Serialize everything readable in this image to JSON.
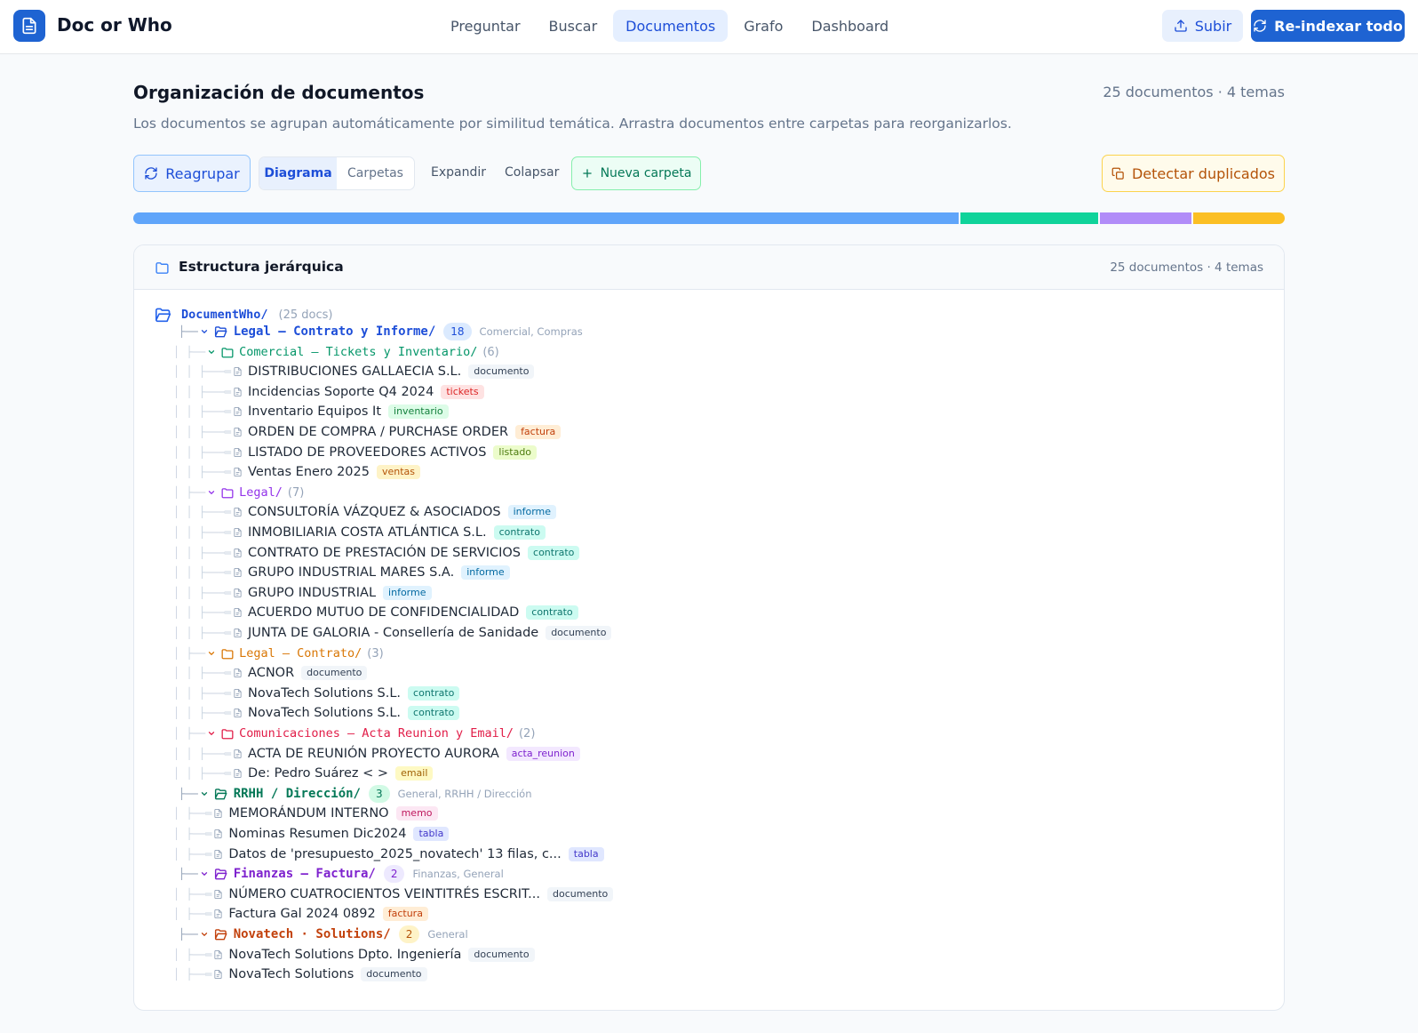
{
  "app": {
    "title": "Doc or Who"
  },
  "nav": {
    "tabs": [
      {
        "label": "Preguntar",
        "active": false
      },
      {
        "label": "Buscar",
        "active": false
      },
      {
        "label": "Documentos",
        "active": true
      },
      {
        "label": "Grafo",
        "active": false
      },
      {
        "label": "Dashboard",
        "active": false
      }
    ]
  },
  "actions": {
    "upload": "Subir",
    "reindex": "Re-indexar todo"
  },
  "page": {
    "title": "Organización de documentos",
    "stats": "25 documentos · 4 temas",
    "description": "Los documentos se agrupan automáticamente por similitud temática. Arrastra documentos entre carpetas para reorganizarlos."
  },
  "toolbar": {
    "regroup": "Reagrupar",
    "view_diagram": "Diagrama",
    "view_folders": "Carpetas",
    "expand": "Expandir",
    "collapse": "Colapsar",
    "new_folder": "Nueva carpeta",
    "detect_duplicates": "Detectar duplicados"
  },
  "distribution": [
    {
      "fraction": 0.72,
      "color": "#60a5fa"
    },
    {
      "fraction": 0.12,
      "color": "#10d39a"
    },
    {
      "fraction": 0.08,
      "color": "#b18cf8"
    },
    {
      "fraction": 0.08,
      "color": "#fbbf24"
    }
  ],
  "tree": {
    "title": "Estructura jerárquica",
    "stats": "25 documentos · 4 temas",
    "root": {
      "name": "DocumentWho/",
      "count": "(25 docs)"
    },
    "rows": [
      {
        "kind": "top",
        "name": "Legal — Contrato y Informe/",
        "pill": "18",
        "topics": "Comercial, Compras",
        "color": "#1d4ed8",
        "pill_bg": "#dbeafe",
        "pill_fg": "#1d4ed8"
      },
      {
        "kind": "sub",
        "name": "Comercial — Tickets y Inventario/",
        "count": "(6)",
        "color": "#059669"
      },
      {
        "kind": "doc",
        "level": 2,
        "name": "DISTRIBUCIONES GALLAECIA S.L.",
        "tag": "documento",
        "tag_bg": "#f1f5f9",
        "tag_fg": "#334155"
      },
      {
        "kind": "doc",
        "level": 2,
        "name": "Incidencias Soporte Q4 2024",
        "tag": "tickets",
        "tag_bg": "#fee2e2",
        "tag_fg": "#dc2626"
      },
      {
        "kind": "doc",
        "level": 2,
        "name": "Inventario Equipos It",
        "tag": "inventario",
        "tag_bg": "#dcfce7",
        "tag_fg": "#15803d"
      },
      {
        "kind": "doc",
        "level": 2,
        "name": "ORDEN DE COMPRA / PURCHASE ORDER",
        "tag": "factura",
        "tag_bg": "#ffedd5",
        "tag_fg": "#c2410c"
      },
      {
        "kind": "doc",
        "level": 2,
        "name": "LISTADO DE PROVEEDORES ACTIVOS",
        "tag": "listado",
        "tag_bg": "#ecfccb",
        "tag_fg": "#4d7c0f"
      },
      {
        "kind": "doc",
        "level": 2,
        "name": "Ventas Enero 2025",
        "tag": "ventas",
        "tag_bg": "#fef3c7",
        "tag_fg": "#b45309"
      },
      {
        "kind": "sub",
        "name": "Legal/",
        "count": "(7)",
        "color": "#9333ea"
      },
      {
        "kind": "doc",
        "level": 2,
        "name": "CONSULTORÍA VÁZQUEZ & ASOCIADOS",
        "tag": "informe",
        "tag_bg": "#e0f2fe",
        "tag_fg": "#0369a1"
      },
      {
        "kind": "doc",
        "level": 2,
        "name": "INMOBILIARIA COSTA ATLÁNTICA S.L.",
        "tag": "contrato",
        "tag_bg": "#ccfbf1",
        "tag_fg": "#0f766e"
      },
      {
        "kind": "doc",
        "level": 2,
        "name": "CONTRATO DE PRESTACIÓN DE SERVICIOS",
        "tag": "contrato",
        "tag_bg": "#ccfbf1",
        "tag_fg": "#0f766e"
      },
      {
        "kind": "doc",
        "level": 2,
        "name": "GRUPO INDUSTRIAL MARES S.A.",
        "tag": "informe",
        "tag_bg": "#e0f2fe",
        "tag_fg": "#0369a1"
      },
      {
        "kind": "doc",
        "level": 2,
        "name": "GRUPO INDUSTRIAL",
        "tag": "informe",
        "tag_bg": "#e0f2fe",
        "tag_fg": "#0369a1"
      },
      {
        "kind": "doc",
        "level": 2,
        "name": "ACUERDO MUTUO DE CONFIDENCIALIDAD",
        "tag": "contrato",
        "tag_bg": "#ccfbf1",
        "tag_fg": "#0f766e"
      },
      {
        "kind": "doc",
        "level": 2,
        "name": "JUNTA DE GALORIA - Consellería de Sanidade",
        "tag": "documento",
        "tag_bg": "#f1f5f9",
        "tag_fg": "#334155"
      },
      {
        "kind": "sub",
        "name": "Legal — Contrato/",
        "count": "(3)",
        "color": "#d97706"
      },
      {
        "kind": "doc",
        "level": 2,
        "name": "ACNOR",
        "tag": "documento",
        "tag_bg": "#f1f5f9",
        "tag_fg": "#334155"
      },
      {
        "kind": "doc",
        "level": 2,
        "name": "NovaTech Solutions S.L.",
        "tag": "contrato",
        "tag_bg": "#ccfbf1",
        "tag_fg": "#0f766e"
      },
      {
        "kind": "doc",
        "level": 2,
        "name": "NovaTech Solutions S.L.",
        "tag": "contrato",
        "tag_bg": "#ccfbf1",
        "tag_fg": "#0f766e"
      },
      {
        "kind": "sub",
        "name": "Comunicaciones — Acta Reunion y Email/",
        "count": "(2)",
        "color": "#e11d48"
      },
      {
        "kind": "doc",
        "level": 2,
        "name": "ACTA DE REUNIÓN PROYECTO AURORA",
        "tag": "acta_reunion",
        "tag_bg": "#f3e8ff",
        "tag_fg": "#7e22ce"
      },
      {
        "kind": "doc",
        "level": 2,
        "name": "De: Pedro Suárez < >",
        "tag": "email",
        "tag_bg": "#fef9c3",
        "tag_fg": "#a16207"
      },
      {
        "kind": "top",
        "name": "RRHH / Dirección/",
        "pill": "3",
        "topics": "General, RRHH / Dirección",
        "color": "#047857",
        "pill_bg": "#d1fae5",
        "pill_fg": "#047857"
      },
      {
        "kind": "doc",
        "level": 1,
        "name": "MEMORÁNDUM INTERNO",
        "tag": "memo",
        "tag_bg": "#fce7f3",
        "tag_fg": "#be185d"
      },
      {
        "kind": "doc",
        "level": 1,
        "name": "Nominas Resumen Dic2024",
        "tag": "tabla",
        "tag_bg": "#e0e7ff",
        "tag_fg": "#4338ca"
      },
      {
        "kind": "doc",
        "level": 1,
        "name": "Datos de 'presupuesto_2025_novatech' 13 filas, c...",
        "tag": "tabla",
        "tag_bg": "#e0e7ff",
        "tag_fg": "#4338ca"
      },
      {
        "kind": "top",
        "name": "Finanzas — Factura/",
        "pill": "2",
        "topics": "Finanzas, General",
        "color": "#7e22ce",
        "pill_bg": "#ede9fe",
        "pill_fg": "#7e22ce"
      },
      {
        "kind": "doc",
        "level": 1,
        "name": "NÚMERO CUATROCIENTOS VEINTITRÉS ESCRIT...",
        "tag": "documento",
        "tag_bg": "#f1f5f9",
        "tag_fg": "#334155"
      },
      {
        "kind": "doc",
        "level": 1,
        "name": "Factura Gal 2024 0892",
        "tag": "factura",
        "tag_bg": "#ffedd5",
        "tag_fg": "#c2410c"
      },
      {
        "kind": "top",
        "name": "Novatech · Solutions/",
        "pill": "2",
        "topics": "General",
        "color": "#c2410c",
        "pill_bg": "#fef3c7",
        "pill_fg": "#b45309"
      },
      {
        "kind": "doc",
        "level": 1,
        "name": "NovaTech Solutions Dpto. Ingeniería",
        "tag": "documento",
        "tag_bg": "#f1f5f9",
        "tag_fg": "#334155"
      },
      {
        "kind": "doc",
        "level": 1,
        "name": "NovaTech Solutions",
        "tag": "documento",
        "tag_bg": "#f1f5f9",
        "tag_fg": "#334155"
      }
    ]
  }
}
